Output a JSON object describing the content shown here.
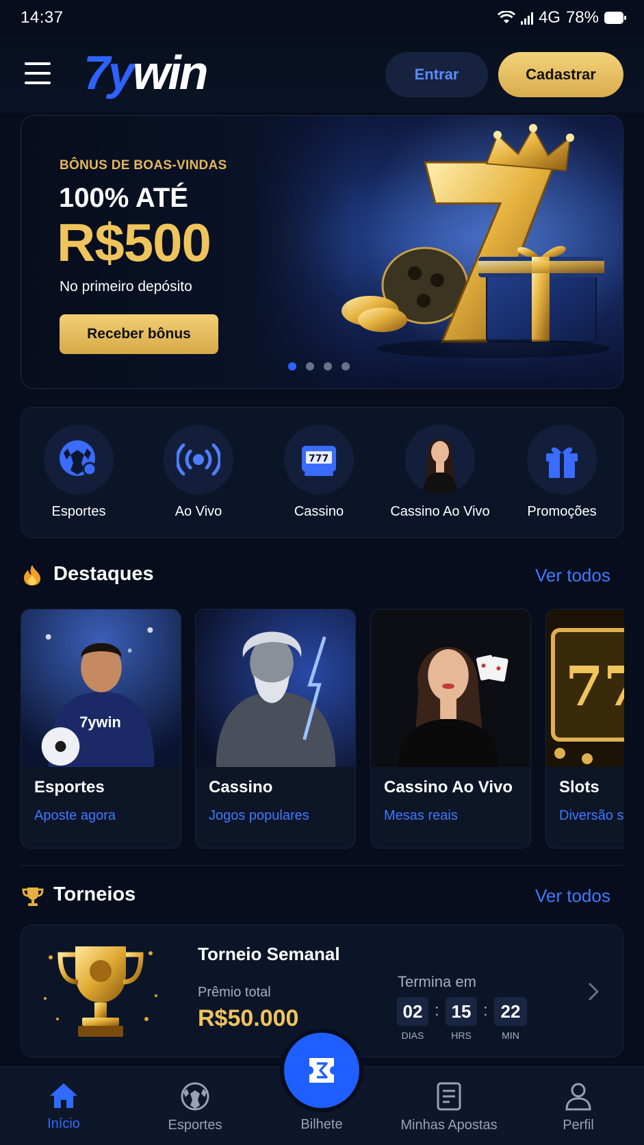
{
  "status": {
    "time": "14:37",
    "network": "4G",
    "battery": "78%"
  },
  "header": {
    "logo_seven": "7y",
    "logo_win": "win",
    "login_label": "Entrar",
    "register_label": "Cadastrar"
  },
  "banner": {
    "eyebrow": "BÔNUS DE BOAS-VINDAS",
    "headline": "100% ATÉ",
    "amount": "R$500",
    "subtitle": "No primeiro depósito",
    "cta": "Receber bônus",
    "slide_count": 4,
    "active_slide": 1
  },
  "categories": [
    {
      "label": "Esportes",
      "icon": "soccer-ball-icon"
    },
    {
      "label": "Ao Vivo",
      "icon": "live-broadcast-icon"
    },
    {
      "label": "Cassino",
      "icon": "slot-machine-icon"
    },
    {
      "label": "Cassino Ao Vivo",
      "icon": "live-dealer-avatar"
    },
    {
      "label": "Promoções",
      "icon": "gift-icon"
    }
  ],
  "highlights": {
    "title": "Destaques",
    "see_all": "Ver todos",
    "cards": [
      {
        "title": "Esportes",
        "subtitle": "Aposte agora",
        "jersey_text": "7ywin"
      },
      {
        "title": "Cassino",
        "subtitle": "Jogos populares"
      },
      {
        "title": "Cassino Ao Vivo",
        "subtitle": "Mesas reais"
      },
      {
        "title": "Slots",
        "subtitle": "Diversão s"
      }
    ]
  },
  "tournaments": {
    "title": "Torneios",
    "see_all": "Ver todos",
    "name": "Torneio Semanal",
    "prize_label": "Prêmio total",
    "prize": "R$50.000",
    "ends_label": "Termina em",
    "countdown": [
      {
        "value": "02",
        "unit": "DIAS"
      },
      {
        "value": "15",
        "unit": "HRS"
      },
      {
        "value": "22",
        "unit": "MIN"
      }
    ]
  },
  "bottom_nav": [
    {
      "label": "Início",
      "icon": "home-icon",
      "active": true
    },
    {
      "label": "Esportes",
      "icon": "soccer-ball-icon"
    },
    {
      "label": "Bilhete",
      "icon": "ticket-icon"
    },
    {
      "label": "Minhas Apostas",
      "icon": "document-icon"
    },
    {
      "label": "Perfil",
      "icon": "user-icon"
    }
  ],
  "colors": {
    "accent_blue": "#2f63ff",
    "gold": "#f0c45c",
    "background": "#070d1c"
  }
}
